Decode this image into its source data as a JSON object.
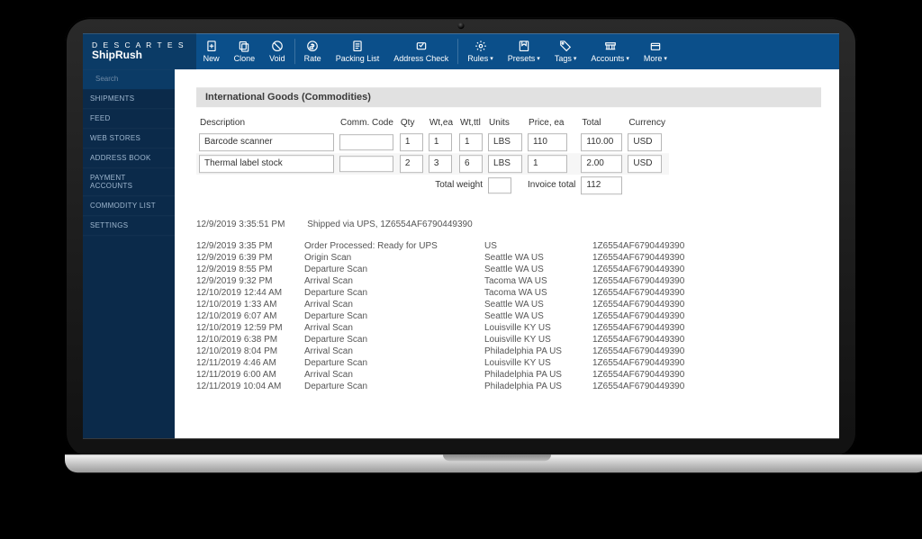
{
  "brand": {
    "line1": "D E S C A R T E S",
    "line2": "ShipRush"
  },
  "toolbar": {
    "new": "New",
    "clone": "Clone",
    "void": "Void",
    "rate": "Rate",
    "packing_list": "Packing List",
    "address_check": "Address Check",
    "rules": "Rules",
    "presets": "Presets",
    "tags": "Tags",
    "accounts": "Accounts",
    "more": "More"
  },
  "sidebar": {
    "search_placeholder": "Search",
    "items": [
      "SHIPMENTS",
      "FEED",
      "WEB STORES",
      "ADDRESS BOOK",
      "PAYMENT ACCOUNTS",
      "COMMODITY LIST",
      "SETTINGS"
    ]
  },
  "section_title": "International Goods (Commodities)",
  "columns": {
    "description": "Description",
    "comm_code": "Comm. Code",
    "qty": "Qty",
    "wt_ea": "Wt,ea",
    "wt_ttl": "Wt,ttl",
    "units": "Units",
    "price_ea": "Price, ea",
    "total": "Total",
    "currency": "Currency"
  },
  "rows": [
    {
      "description": "Barcode scanner",
      "comm_code": "",
      "qty": "1",
      "wt_ea": "1",
      "wt_ttl": "1",
      "units": "LBS",
      "price_ea": "110",
      "total": "110.00",
      "currency": "USD"
    },
    {
      "description": "Thermal label stock",
      "comm_code": "",
      "qty": "2",
      "wt_ea": "3",
      "wt_ttl": "6",
      "units": "LBS",
      "price_ea": "1",
      "total": "2.00",
      "currency": "USD"
    }
  ],
  "totals": {
    "total_weight_label": "Total weight",
    "total_weight_value": "",
    "invoice_total_label": "Invoice total",
    "invoice_total_value": "112"
  },
  "shipment_summary": {
    "timestamp": "12/9/2019 3:35:51 PM",
    "text": "Shipped via UPS, 1Z6554AF6790449390"
  },
  "history": [
    {
      "ts": "12/9/2019 3:35 PM",
      "event": "Order Processed: Ready for UPS",
      "loc": "US",
      "track": "1Z6554AF6790449390"
    },
    {
      "ts": "12/9/2019 6:39 PM",
      "event": "Origin Scan",
      "loc": "Seattle WA US",
      "track": "1Z6554AF6790449390"
    },
    {
      "ts": "12/9/2019 8:55 PM",
      "event": "Departure Scan",
      "loc": "Seattle WA US",
      "track": "1Z6554AF6790449390"
    },
    {
      "ts": "12/9/2019 9:32 PM",
      "event": "Arrival Scan",
      "loc": "Tacoma WA US",
      "track": "1Z6554AF6790449390"
    },
    {
      "ts": "12/10/2019 12:44 AM",
      "event": "Departure Scan",
      "loc": "Tacoma WA US",
      "track": "1Z6554AF6790449390"
    },
    {
      "ts": "12/10/2019 1:33 AM",
      "event": "Arrival Scan",
      "loc": "Seattle WA US",
      "track": "1Z6554AF6790449390"
    },
    {
      "ts": "12/10/2019 6:07 AM",
      "event": "Departure Scan",
      "loc": "Seattle WA US",
      "track": "1Z6554AF6790449390"
    },
    {
      "ts": "12/10/2019 12:59 PM",
      "event": "Arrival Scan",
      "loc": "Louisville KY US",
      "track": "1Z6554AF6790449390"
    },
    {
      "ts": "12/10/2019 6:38 PM",
      "event": "Departure Scan",
      "loc": "Louisville KY US",
      "track": "1Z6554AF6790449390"
    },
    {
      "ts": "12/10/2019 8:04 PM",
      "event": "Arrival Scan",
      "loc": "Philadelphia PA US",
      "track": "1Z6554AF6790449390"
    },
    {
      "ts": "12/11/2019 4:46 AM",
      "event": "Departure Scan",
      "loc": "Louisville KY US",
      "track": "1Z6554AF6790449390"
    },
    {
      "ts": "12/11/2019 6:00 AM",
      "event": "Arrival Scan",
      "loc": "Philadelphia PA US",
      "track": "1Z6554AF6790449390"
    },
    {
      "ts": "12/11/2019 10:04 AM",
      "event": "Departure Scan",
      "loc": "Philadelphia PA US",
      "track": "1Z6554AF6790449390"
    }
  ]
}
